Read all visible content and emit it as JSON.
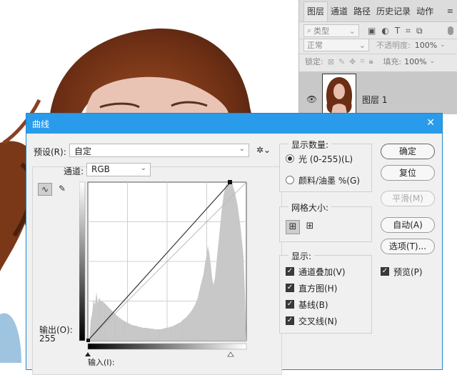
{
  "layers_panel": {
    "tabs": [
      "图层",
      "通道",
      "路径",
      "历史记录",
      "动作"
    ],
    "menu_icon": "panel-menu-icon",
    "filter": {
      "search_icon": "search-icon",
      "value": "类型"
    },
    "filter_icons": [
      "image-filter-icon",
      "adjustment-filter-icon",
      "type-filter-icon",
      "shape-filter-icon",
      "smart-object-filter-icon"
    ],
    "blend_mode": "正常",
    "opacity_label": "不透明度:",
    "opacity_value": "100%",
    "lock_label": "锁定:",
    "fill_label": "填充:",
    "fill_value": "100%",
    "layer_name": "图层 1"
  },
  "curves_dialog": {
    "title": "曲线",
    "preset_label": "预设(R):",
    "preset_value": "自定",
    "channel_label": "通道:",
    "channel_value": "RGB",
    "output_label": "输出(O):",
    "output_value": "255",
    "input_label": "输入(I):",
    "show_amount": {
      "title": "显示数量:",
      "light": "光 (0-255)(L)",
      "pigment": "颜料/油墨 %(G)",
      "selected": "light"
    },
    "grid_size": {
      "title": "网格大小:",
      "selected": "simple"
    },
    "show": {
      "title": "显示:",
      "items": [
        {
          "label": "通道叠加(V)",
          "checked": true
        },
        {
          "label": "直方图(H)",
          "checked": true
        },
        {
          "label": "基线(B)",
          "checked": true
        },
        {
          "label": "交叉线(N)",
          "checked": true
        }
      ]
    },
    "buttons": {
      "ok": "确定",
      "reset": "复位",
      "smooth": "平滑(M)",
      "auto": "自动(A)",
      "options": "选项(T)..."
    },
    "preview": {
      "label": "预览(P)",
      "checked": true
    },
    "accent_color": "#2a9bea"
  }
}
